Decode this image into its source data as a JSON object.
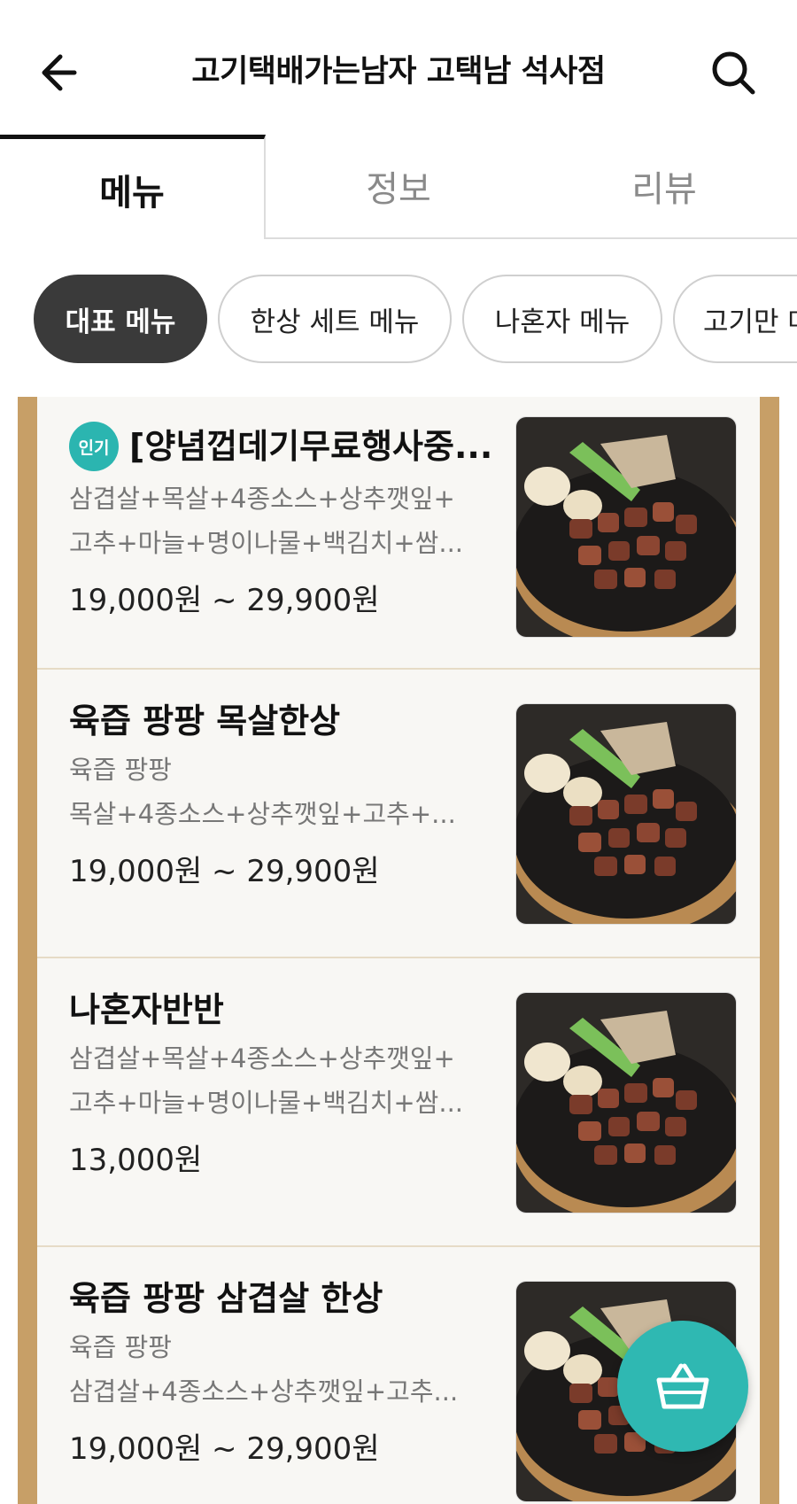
{
  "header": {
    "title": "고기택배가는남자 고택남 석사점"
  },
  "tabs": [
    {
      "label": "메뉴"
    },
    {
      "label": "정보"
    },
    {
      "label": "리뷰"
    }
  ],
  "categories": [
    {
      "label": "대표 메뉴"
    },
    {
      "label": "한상 세트 메뉴"
    },
    {
      "label": "나혼자 메뉴"
    },
    {
      "label": "고기만 메"
    }
  ],
  "menu_items": [
    {
      "badge": "인기",
      "name": "[양념껍데기무료행사중...",
      "lines": [
        "삼겹살+목살+4종소스+상추깻잎+",
        "고추+마늘+명이나물+백김치+쌈..."
      ],
      "price": "19,000원 ~ 29,900원"
    },
    {
      "name": "육즙 팡팡 목살한상",
      "lines": [
        "육즙 팡팡",
        "목살+4종소스+상추깻잎+고추+..."
      ],
      "price": "19,000원 ~ 29,900원"
    },
    {
      "name": "나혼자반반",
      "lines": [
        "삼겹살+목살+4종소스+상추깻잎+",
        "고추+마늘+명이나물+백김치+쌈..."
      ],
      "price": "13,000원"
    },
    {
      "name": "육즙 팡팡 삼겹살 한상",
      "lines": [
        "육즙 팡팡",
        "삼겹살+4종소스+상추깻잎+고추..."
      ],
      "price": "19,000원 ~ 29,900원"
    }
  ],
  "colors": {
    "accent": "#2fb8b2",
    "frame": "#c79f67",
    "chip_active": "#3a3a3a"
  },
  "icons": {
    "back": "arrow-left-icon",
    "search": "search-icon",
    "cart": "basket-icon"
  }
}
